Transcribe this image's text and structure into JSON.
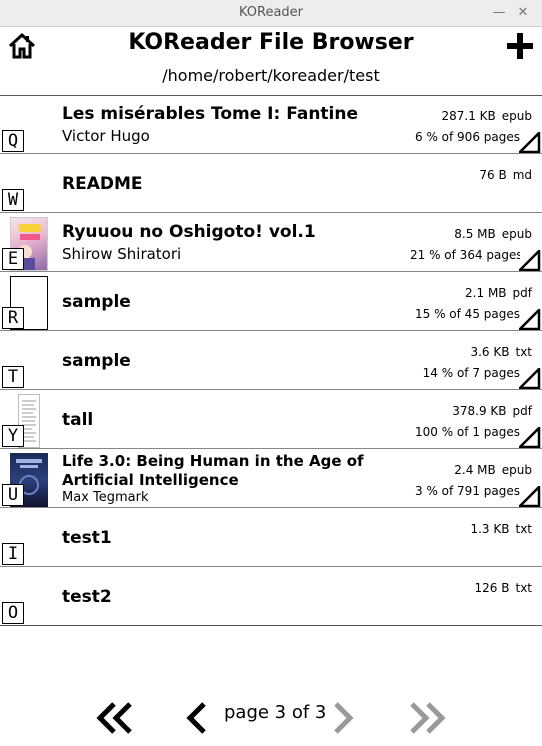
{
  "window": {
    "title": "KOReader"
  },
  "header": {
    "title": "KOReader File Browser",
    "path": "/home/robert/koreader/test"
  },
  "rows": [
    {
      "key": "Q",
      "name": "Les misérables Tome I: Fantine",
      "author": "Victor Hugo",
      "size": "287.1 KB",
      "ext": "epub",
      "progress": "6 % of 906 pages"
    },
    {
      "key": "W",
      "name": "README",
      "author": "",
      "size": "76 B",
      "ext": "md",
      "progress": ""
    },
    {
      "key": "E",
      "name": "Ryuuou no Oshigoto! vol.1",
      "author": "Shirow Shiratori",
      "size": "8.5 MB",
      "ext": "epub",
      "progress": "21 % of 364 pages"
    },
    {
      "key": "R",
      "name": "sample",
      "author": "",
      "size": "2.1 MB",
      "ext": "pdf",
      "progress": "15 % of 45 pages"
    },
    {
      "key": "T",
      "name": "sample",
      "author": "",
      "size": "3.6 KB",
      "ext": "txt",
      "progress": "14 % of 7 pages"
    },
    {
      "key": "Y",
      "name": "tall",
      "author": "",
      "size": "378.9 KB",
      "ext": "pdf",
      "progress": "100 % of 1 pages"
    },
    {
      "key": "U",
      "name": "Life 3.0: Being Human in the Age of Artificial Intelligence",
      "author": "Max Tegmark",
      "size": "2.4 MB",
      "ext": "epub",
      "progress": "3 % of 791 pages"
    },
    {
      "key": "I",
      "name": "test1",
      "author": "",
      "size": "1.3 KB",
      "ext": "txt",
      "progress": ""
    },
    {
      "key": "O",
      "name": "test2",
      "author": "",
      "size": "126 B",
      "ext": "txt",
      "progress": ""
    }
  ],
  "footer": {
    "page_label": "page 3 of 3"
  }
}
